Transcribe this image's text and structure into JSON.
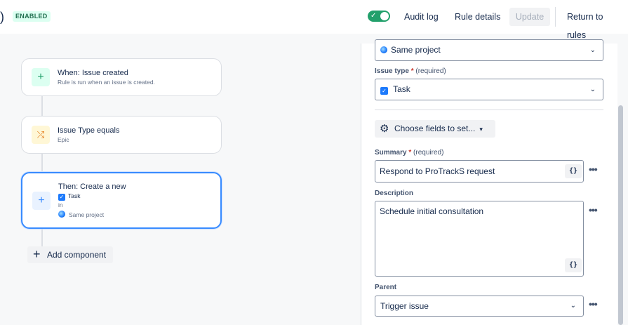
{
  "header": {
    "paren": ")",
    "status_badge": "ENABLED",
    "toggle_check": "✓",
    "audit_log": "Audit log",
    "rule_details": "Rule details",
    "update": "Update",
    "return_to_rules": "Return to rules"
  },
  "canvas": {
    "trigger": {
      "icon": "plus-icon",
      "title": "When: Issue created",
      "subtitle": "Rule is run when an issue is created."
    },
    "condition": {
      "icon": "shuffle-icon",
      "title": "Issue Type equals",
      "subtitle": "Epic"
    },
    "action": {
      "icon": "plus-icon",
      "title": "Then: Create a new",
      "type": "Task",
      "in": "in",
      "project": "Same project"
    },
    "add_component": "Add component"
  },
  "panel": {
    "project_value": "Same project",
    "issue_type": {
      "label": "Issue type",
      "required_mark": "*",
      "required_text": "(required)",
      "value": "Task"
    },
    "choose_fields": "Choose fields to set...",
    "summary": {
      "label": "Summary",
      "required_mark": "*",
      "required_text": "(required)",
      "value": "Respond to ProTrackS request"
    },
    "description": {
      "label": "Description",
      "value": "Schedule initial consultation"
    },
    "parent": {
      "label": "Parent",
      "value": "Trigger issue"
    },
    "smart_value": "{}",
    "more": "•••"
  }
}
